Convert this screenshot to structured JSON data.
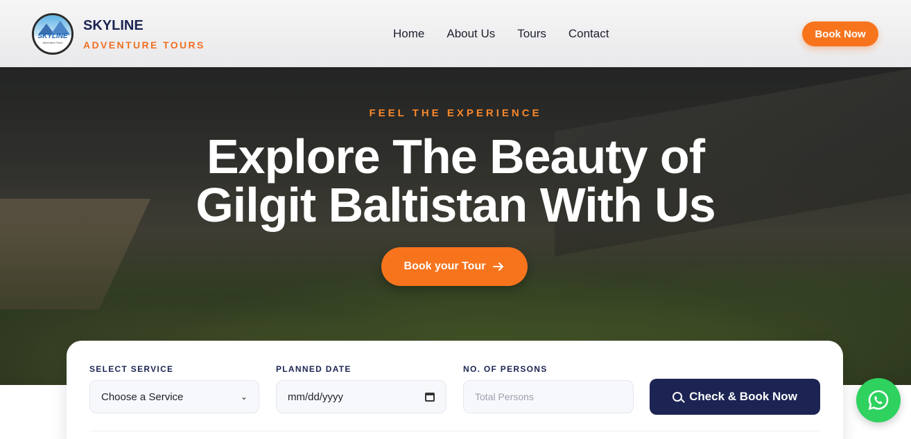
{
  "brand": {
    "logo_word": "SKYLINE",
    "logo_sub": "Adventure Tours",
    "name": "SKYLINE",
    "tagline": "ADVENTURE TOURS"
  },
  "nav": {
    "items": [
      "Home",
      "About Us",
      "Tours",
      "Contact"
    ]
  },
  "header": {
    "book_label": "Book Now"
  },
  "hero": {
    "kicker": "FEEL THE EXPERIENCE",
    "headline_line1": "Explore The Beauty of",
    "headline_line2": "Gilgit Baltistan With Us",
    "cta_label": "Book your Tour",
    "cta_icon": "arrow-right-icon"
  },
  "booking": {
    "service_label": "SELECT SERVICE",
    "service_value": "Choose a Service",
    "date_label": "PLANNED DATE",
    "date_value": "mm/dd/yyyy",
    "persons_label": "NO. OF PERSONS",
    "persons_placeholder": "Total Persons",
    "submit_label": "Check & Book Now",
    "submit_icon": "search-icon"
  },
  "colors": {
    "accent": "#f7741d",
    "navy": "#1b2452",
    "whatsapp": "#2fd15f"
  },
  "floating": {
    "whatsapp_icon": "whatsapp-icon"
  }
}
